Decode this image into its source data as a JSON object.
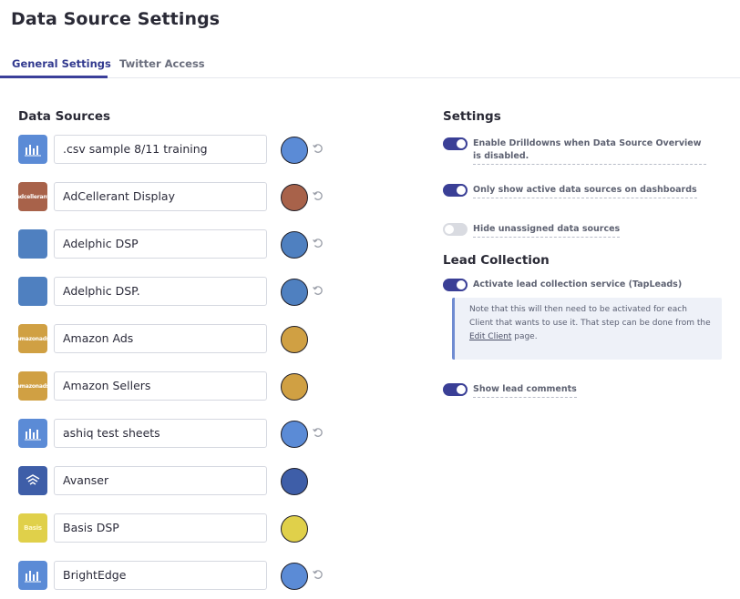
{
  "page": {
    "title": "Data Source Settings"
  },
  "tabs": [
    {
      "label": "General Settings",
      "active": true
    },
    {
      "label": "Twitter Access",
      "active": false
    }
  ],
  "data_sources": {
    "title": "Data Sources",
    "items": [
      {
        "name": ".csv sample 8/11 training",
        "logo": "bar-chart-icon",
        "logo_text": "",
        "logo_bg": "#5b8bd6",
        "color": "#5b8bd6",
        "has_reset": true
      },
      {
        "name": "AdCellerant Display",
        "logo": "adcellerant-logo",
        "logo_text": "adcellerant",
        "logo_bg": "#a8624a",
        "color": "#a8624a",
        "has_reset": true
      },
      {
        "name": "Adelphic DSP",
        "logo": "adelphic-logo",
        "logo_text": "",
        "logo_bg": "#4f80c0",
        "color": "#4f80c0",
        "has_reset": true
      },
      {
        "name": "Adelphic DSP.",
        "logo": "adelphic-logo",
        "logo_text": "",
        "logo_bg": "#4f80c0",
        "color": "#4f80c0",
        "has_reset": true
      },
      {
        "name": "Amazon Ads",
        "logo": "amazon-ads-logo",
        "logo_text": "amazonads",
        "logo_bg": "#d0a043",
        "color": "#d0a043",
        "has_reset": false
      },
      {
        "name": "Amazon Sellers",
        "logo": "amazon-sellers-logo",
        "logo_text": "amazonads",
        "logo_bg": "#d0a043",
        "color": "#d0a043",
        "has_reset": false
      },
      {
        "name": "ashiq test sheets",
        "logo": "bar-chart-icon",
        "logo_text": "",
        "logo_bg": "#5b8bd6",
        "color": "#5b8bd6",
        "has_reset": true
      },
      {
        "name": "Avanser",
        "logo": "avanser-logo",
        "logo_text": "",
        "logo_bg": "#3e5ea8",
        "color": "#3e5ea8",
        "has_reset": false
      },
      {
        "name": "Basis DSP",
        "logo": "basis-logo",
        "logo_text": "Basis",
        "logo_bg": "#e0d04a",
        "color": "#e0d04a",
        "has_reset": false
      },
      {
        "name": "BrightEdge",
        "logo": "bar-chart-icon",
        "logo_text": "",
        "logo_bg": "#5b8bd6",
        "color": "#5b8bd6",
        "has_reset": true
      }
    ]
  },
  "settings": {
    "title": "Settings",
    "toggles": [
      {
        "label": "Enable Drilldowns when Data Source Overview is disabled.",
        "on": true
      },
      {
        "label": "Only show active data sources on dashboards",
        "on": true
      },
      {
        "label": "Hide unassigned data sources",
        "on": false
      }
    ]
  },
  "lead_collection": {
    "title": "Lead Collection",
    "service_toggle": {
      "label": "Activate lead collection service (TapLeads)",
      "on": true
    },
    "note": {
      "text": "Note that this will then need to be activated for each Client that wants to use it. That step can be done from the",
      "link": "Edit Client",
      "suffix": "page."
    },
    "comments_toggle": {
      "label": "Show lead comments",
      "on": true
    }
  }
}
